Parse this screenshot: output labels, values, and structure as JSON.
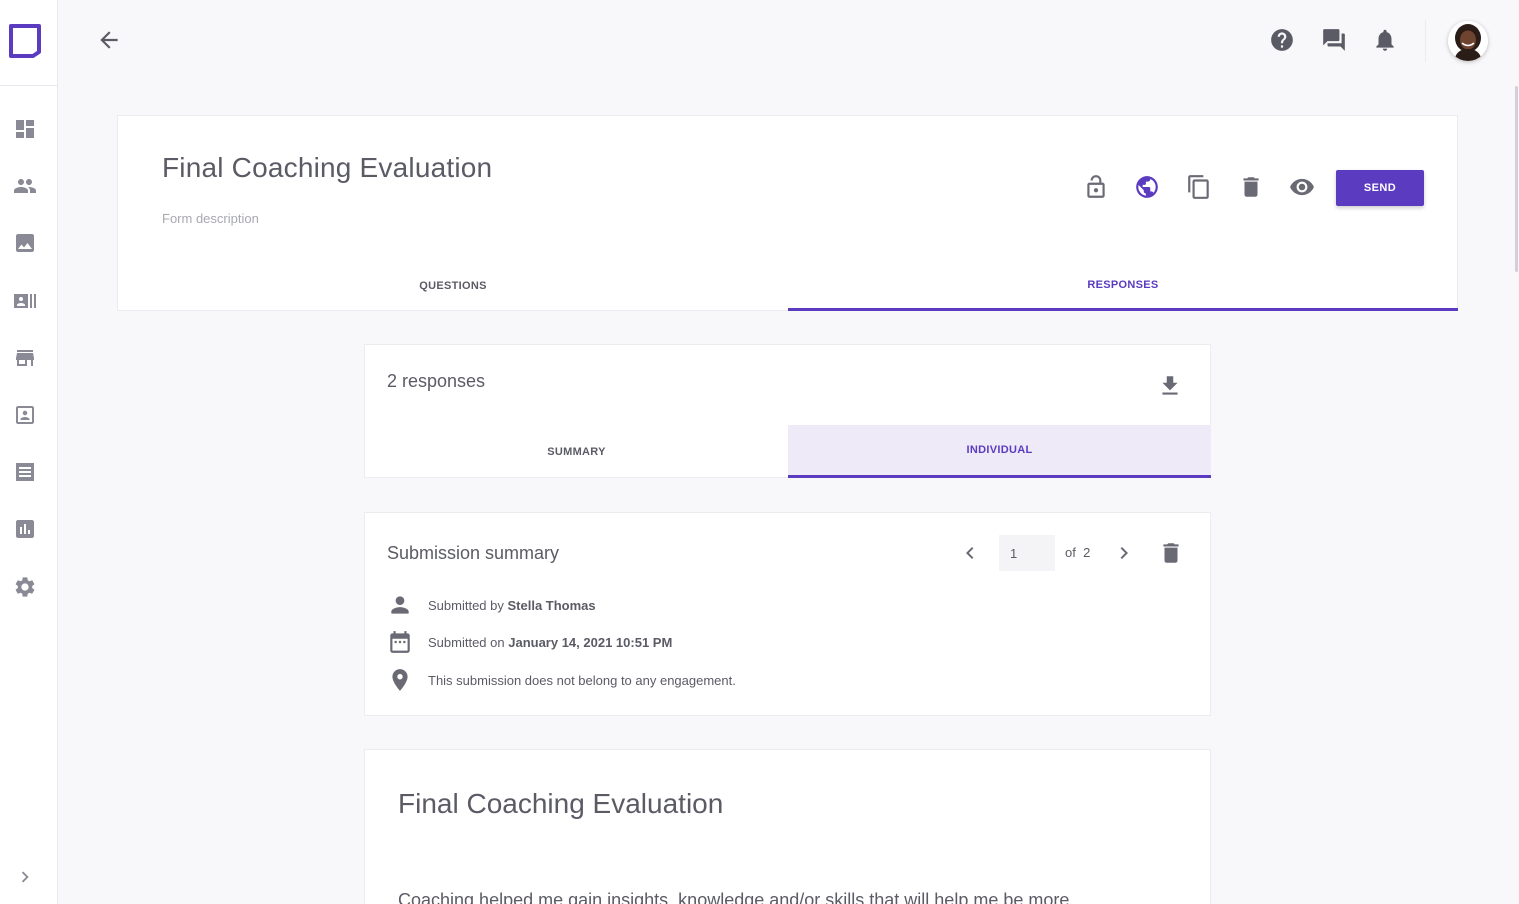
{
  "colors": {
    "accent": "#5b3bbf",
    "accent_tint": "#efeaf8",
    "text": "#5b5b66",
    "muted": "#a8a8b2"
  },
  "sidebar": {
    "items": [
      {
        "icon": "dashboard-icon"
      },
      {
        "icon": "people-icon"
      },
      {
        "icon": "image-icon"
      },
      {
        "icon": "contact-card-icon"
      },
      {
        "icon": "store-icon"
      },
      {
        "icon": "portrait-icon"
      },
      {
        "icon": "receipt-icon"
      },
      {
        "icon": "bar-chart-icon"
      },
      {
        "icon": "gear-icon"
      }
    ]
  },
  "form": {
    "title": "Final Coaching Evaluation",
    "description_placeholder": "Form description",
    "send_label": "SEND",
    "tabs": {
      "questions": "QUESTIONS",
      "responses": "RESPONSES"
    }
  },
  "responses": {
    "count_label": "2 responses",
    "tabs": {
      "summary": "SUMMARY",
      "individual": "INDIVIDUAL"
    }
  },
  "submission": {
    "title": "Submission summary",
    "pager": {
      "current": "1",
      "of_label": "of",
      "total": "2"
    },
    "submitted_by_prefix": "Submitted by",
    "submitted_by_name": "Stella Thomas",
    "submitted_on_prefix": "Submitted on",
    "submitted_on_date": "January 14, 2021 10:51 PM",
    "engagement_text": "This submission does not belong to any engagement."
  },
  "preview": {
    "title": "Final Coaching Evaluation",
    "question_text": "Coaching helped me gain insights, knowledge and/or skills that will help me be more"
  }
}
